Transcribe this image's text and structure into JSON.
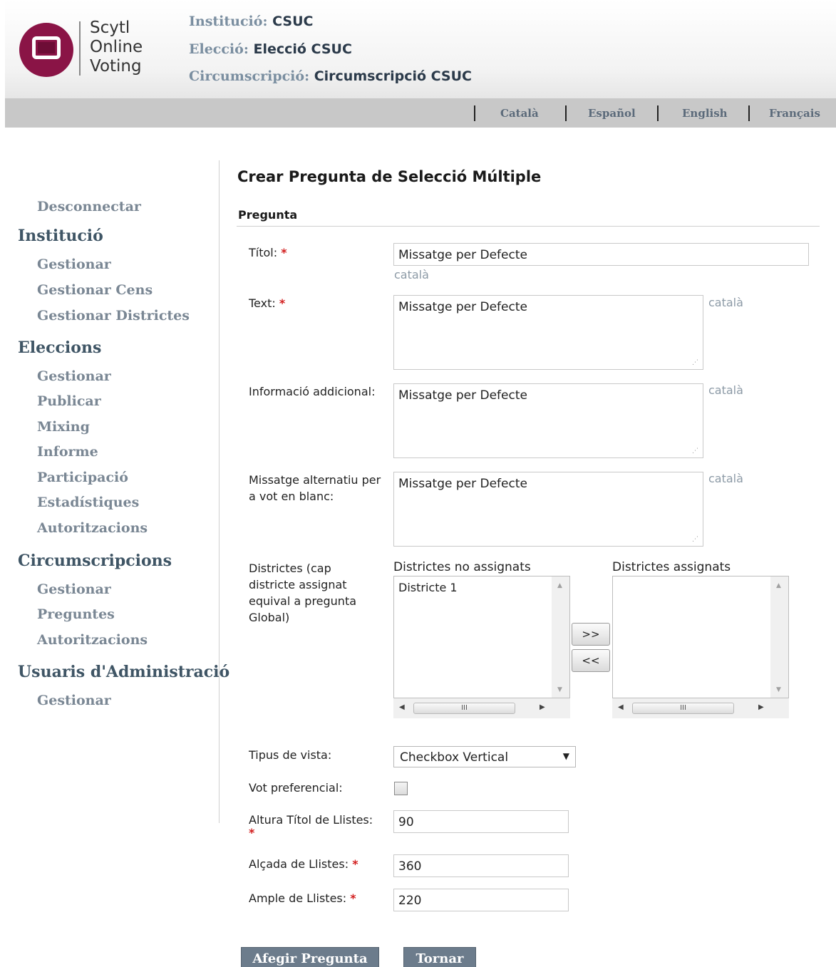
{
  "app": {
    "logo_lines": [
      "Scytl",
      "Online",
      "Voting"
    ]
  },
  "context": {
    "institution_label": "Institució:",
    "institution_value": "CSUC",
    "election_label": "Elecció:",
    "election_value": "Elecció CSUC",
    "district_label": "Circumscripció:",
    "district_value": "Circumscripció CSUC"
  },
  "languages": [
    "Català",
    "Español",
    "English",
    "Français"
  ],
  "sidebar": {
    "disconnect": "Desconnectar",
    "sections": [
      {
        "heading": "Institució",
        "items": [
          "Gestionar",
          "Gestionar Cens",
          "Gestionar Districtes"
        ]
      },
      {
        "heading": "Eleccions",
        "items": [
          "Gestionar",
          "Publicar",
          "Mixing",
          "Informe",
          "Participació",
          "Estadístiques",
          "Autoritzacions"
        ]
      },
      {
        "heading": "Circumscripcions",
        "items": [
          "Gestionar",
          "Preguntes",
          "Autoritzacions"
        ]
      },
      {
        "heading": "Usuaris d'Administració",
        "items": [
          "Gestionar"
        ]
      }
    ]
  },
  "form": {
    "page_title": "Crear Pregunta de Selecció Múltiple",
    "section_title": "Pregunta",
    "required_mark": "*",
    "lang_note": "català",
    "title_label": "Títol:",
    "title_value": "Missatge per Defecte",
    "text_label": "Text:",
    "text_value": "Missatge per Defecte",
    "info_label": "Informació addicional:",
    "info_value": "Missatge per Defecte",
    "blank_label_1": "Missatge alternatiu per",
    "blank_label_2": "a vot en blanc:",
    "blank_value": "Missatge per Defecte",
    "districts_label_lines": [
      "Districtes (cap",
      "districte assignat",
      "equival a pregunta",
      "Global)"
    ],
    "unassigned_title": "Districtes no assignats",
    "unassigned_items": [
      "Districte 1"
    ],
    "assigned_title": "Districtes assignats",
    "assigned_items": [],
    "add_btn": ">>",
    "remove_btn": "<<",
    "view_label": "Tipus de vista:",
    "view_value": "Checkbox Vertical",
    "preferential_label": "Vot preferencial:",
    "preferential_checked": false,
    "list_title_height_label": "Altura Títol de Llistes:",
    "list_title_height_value": "90",
    "list_height_label": "Alçada de Llistes:",
    "list_height_value": "360",
    "list_width_label": "Ample de Llistes:",
    "list_width_value": "220",
    "submit_btn": "Afegir Pregunta",
    "back_btn": "Tornar",
    "scroll_thumb_glyph": "III"
  }
}
